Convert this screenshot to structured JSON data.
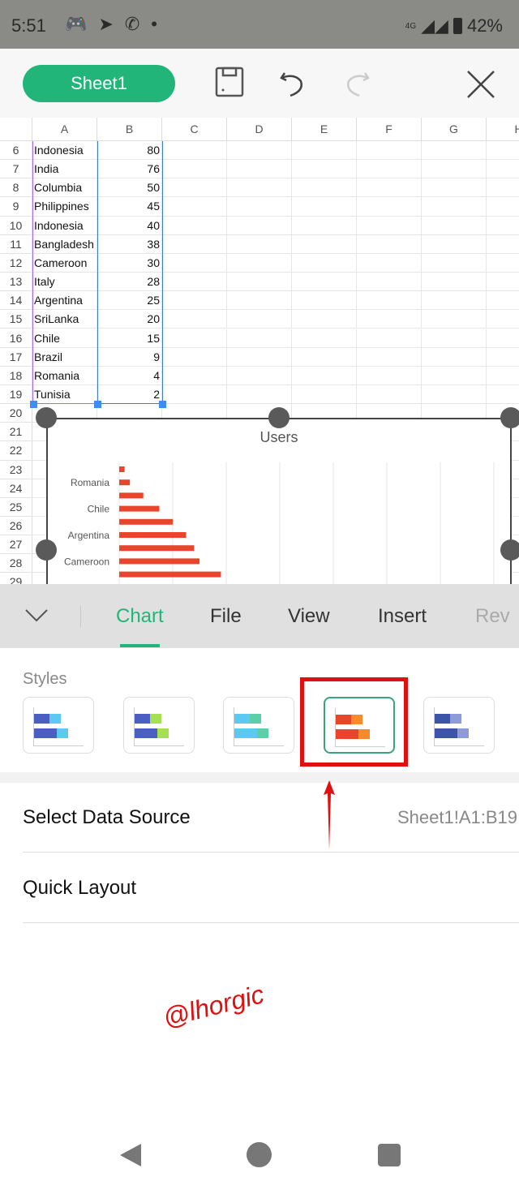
{
  "status_bar": {
    "time": "5:51",
    "battery": "42%",
    "network": "4G",
    "icons": [
      "discord-icon",
      "telegram-icon",
      "whatsapp-icon",
      "dot-icon"
    ]
  },
  "toolbar": {
    "sheet_name": "Sheet1",
    "icons": [
      "save-icon",
      "undo-icon",
      "redo-icon",
      "close-icon"
    ]
  },
  "spreadsheet": {
    "columns": [
      "A",
      "B",
      "C",
      "D",
      "E",
      "F",
      "G",
      "H"
    ],
    "rows": [
      {
        "n": "6",
        "a": "Indonesia",
        "b": "80"
      },
      {
        "n": "7",
        "a": "India",
        "b": "76"
      },
      {
        "n": "8",
        "a": "Columbia",
        "b": "50"
      },
      {
        "n": "9",
        "a": "Philippines",
        "b": "45"
      },
      {
        "n": "10",
        "a": "Indonesia",
        "b": "40"
      },
      {
        "n": "11",
        "a": "Bangladesh",
        "b": "38"
      },
      {
        "n": "12",
        "a": "Cameroon",
        "b": "30"
      },
      {
        "n": "13",
        "a": "Italy",
        "b": "28"
      },
      {
        "n": "14",
        "a": "Argentina",
        "b": "25"
      },
      {
        "n": "15",
        "a": "SriLanka",
        "b": "20"
      },
      {
        "n": "16",
        "a": "Chile",
        "b": "15"
      },
      {
        "n": "17",
        "a": "Brazil",
        "b": "9"
      },
      {
        "n": "18",
        "a": "Romania",
        "b": "4"
      },
      {
        "n": "19",
        "a": "Tunisia",
        "b": "2"
      },
      {
        "n": "20",
        "a": "",
        "b": ""
      },
      {
        "n": "21",
        "a": "",
        "b": ""
      },
      {
        "n": "22",
        "a": "",
        "b": ""
      },
      {
        "n": "23",
        "a": "",
        "b": ""
      },
      {
        "n": "24",
        "a": "",
        "b": ""
      },
      {
        "n": "25",
        "a": "",
        "b": ""
      },
      {
        "n": "26",
        "a": "",
        "b": ""
      },
      {
        "n": "27",
        "a": "",
        "b": ""
      },
      {
        "n": "28",
        "a": "",
        "b": ""
      },
      {
        "n": "29",
        "a": "",
        "b": ""
      }
    ]
  },
  "chart_data": {
    "type": "bar",
    "orientation": "horizontal",
    "title": "Users",
    "categories": [
      "Tunisia",
      "Romania",
      "Brazil",
      "Chile",
      "SriLanka",
      "Argentina",
      "Italy",
      "Cameroon",
      "Bangladesh"
    ],
    "values": [
      2,
      4,
      9,
      15,
      20,
      25,
      28,
      30,
      38
    ],
    "tick_labels_shown": [
      "Romania",
      "Chile",
      "Argentina",
      "Cameroon"
    ],
    "xlim": [
      0,
      140
    ],
    "grid": true,
    "bar_color": "#e8452c"
  },
  "ribbon": {
    "tabs": [
      "Chart",
      "File",
      "View",
      "Insert",
      "Rev"
    ],
    "active": "Chart",
    "accent": "#22b57a"
  },
  "styles": {
    "label": "Styles",
    "selected_index": 3,
    "cards": [
      [
        "#4a5fc1",
        "#5ccaf0"
      ],
      [
        "#4a5fc1",
        "#a6e052"
      ],
      [
        "#5ccaf0",
        "#5ccfa8"
      ],
      [
        "#e8452c",
        "#f98a2c"
      ],
      [
        "#3d55a8",
        "#8f9ad8"
      ]
    ]
  },
  "options": {
    "select_data_source": "Select Data Source",
    "data_range": "Sheet1!A1:B19",
    "quick_layout": "Quick Layout"
  },
  "watermark": "@lhorgic"
}
